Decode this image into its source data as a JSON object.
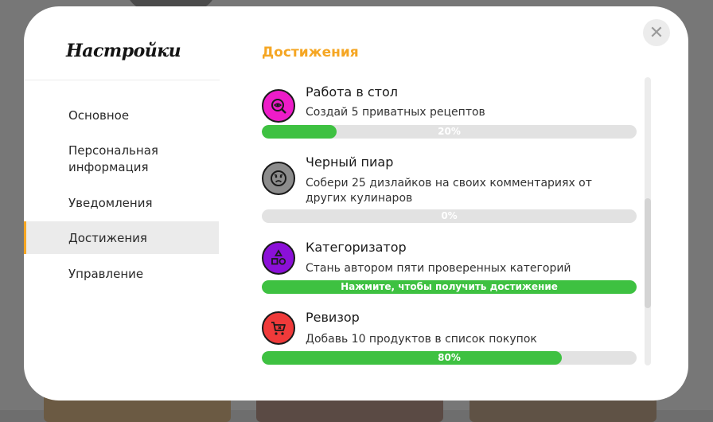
{
  "modal": {
    "title": "Настройки",
    "close_glyph": "✕"
  },
  "sidebar": {
    "items": [
      {
        "label": "Основное"
      },
      {
        "label": "Персональная информация"
      },
      {
        "label": "Уведомления"
      },
      {
        "label": "Достижения",
        "active": true
      },
      {
        "label": "Управление"
      }
    ]
  },
  "main": {
    "section_title": "Достижения",
    "achievements": [
      {
        "title": "Работа в стол",
        "description": "Создай 5 приватных рецептов",
        "progress": 0.2,
        "progress_label": "20%",
        "icon": "eye-magnifier-icon",
        "icon_color": "#ee1cc9"
      },
      {
        "title": "Черный пиар",
        "description": "Собери 25 дизлайков на своих комментариях от других кулинаров",
        "progress": 0,
        "progress_label": "0%",
        "icon": "sad-face-icon",
        "icon_color": "#8c8c8c"
      },
      {
        "title": "Категоризатор",
        "description": "Стань автором пяти проверенных категорий",
        "progress": 1,
        "progress_label": "Нажмите, чтобы получить достижение",
        "icon": "shapes-icon",
        "icon_color": "#8b10d8"
      },
      {
        "title": "Ревизор",
        "description": "Добавь 10 продуктов в список покупок",
        "progress": 0.8,
        "progress_label": "80%",
        "icon": "cart-icon",
        "icon_color": "#f03a3a"
      }
    ]
  },
  "colors": {
    "accent": "#f5a623",
    "progress": "#3ec141",
    "track": "#e2e2e2"
  }
}
